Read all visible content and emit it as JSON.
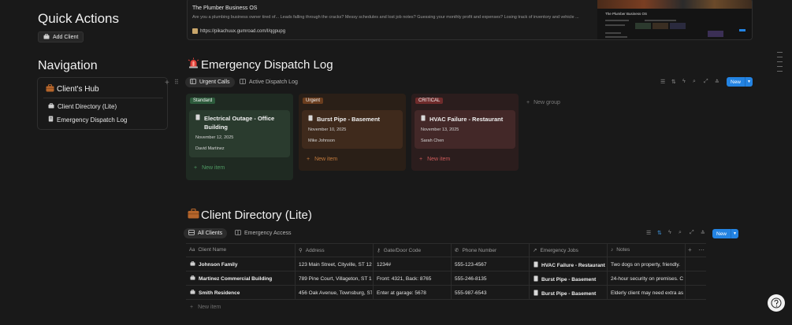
{
  "quick_actions": {
    "title": "Quick Actions",
    "add_client": "Add Client"
  },
  "navigation": {
    "title": "Navigation",
    "hub": "Client's Hub",
    "links": [
      "Client Directory (Lite)",
      "Emergency Dispatch Log"
    ]
  },
  "bookmark": {
    "title": "The Plumber Business OS",
    "description": "Are you a plumbing business owner tired of... Leads falling through the cracks? Messy schedules and lost job notes? Guessing your monthly profit and expenses? Losing track of inventory and vehicle ...",
    "url": "https://pikachuux.gumroad.com/l/qgpupg",
    "thumb_title": "The Plumber Business OS"
  },
  "dispatch": {
    "title": "Emergency Dispatch Log",
    "tabs": [
      "Urgent Calls",
      "Active Dispatch Log"
    ],
    "new_label": "New",
    "new_group": "New group",
    "new_item": "New item",
    "columns": [
      {
        "name": "Standard",
        "badge_color": "#2c5a3b",
        "bg": "#1f2a22",
        "card_bg": "#2a3b2e",
        "accent": "#4f9a63",
        "card": {
          "title": "Electrical Outage - Office Building",
          "date": "November 12, 2025",
          "person": "David Martinez"
        }
      },
      {
        "name": "Urgent",
        "badge_color": "#6a3d1e",
        "bg": "#2a1f17",
        "card_bg": "#3f2a1c",
        "accent": "#c27a3d",
        "card": {
          "title": "Burst Pipe - Basement",
          "date": "November 10, 2025",
          "person": "Mike Johnson"
        }
      },
      {
        "name": "CRITICAL",
        "badge_color": "#6e2b2b",
        "bg": "#2b1d1d",
        "card_bg": "#432828",
        "accent": "#cc5a5a",
        "card": {
          "title": "HVAC Failure - Restaurant",
          "date": "November 13, 2025",
          "person": "Sarah Chen"
        }
      }
    ]
  },
  "directory": {
    "title": "Client Directory (Lite)",
    "tabs": [
      "All Clients",
      "Emergency Access"
    ],
    "new_label": "New",
    "headers": [
      "Client Name",
      "Address",
      "Gate/Door Code",
      "Phone Number",
      "Emergency Jobs",
      "Notes"
    ],
    "rows": [
      [
        "Johnson Family",
        "123 Main Street, Cityville, ST 12",
        "1234#",
        "555-123-4567",
        "HVAC Failure - Restaurant",
        "Two dogs on property, friendly."
      ],
      [
        "Martinez Commercial Building",
        "789 Pine Court, Villageton, ST 1",
        "Front: 4321, Back: 8765",
        "555-246-8135",
        "Burst Pipe - Basement",
        "24-hour security on premises. C"
      ],
      [
        "Smith Residence",
        "456 Oak Avenue, Townsburg, ST",
        "Enter at garage: 5678",
        "555-987-6543",
        "Burst Pipe - Basement",
        "Elderly client may need extra as"
      ]
    ],
    "new_row": "New item"
  }
}
